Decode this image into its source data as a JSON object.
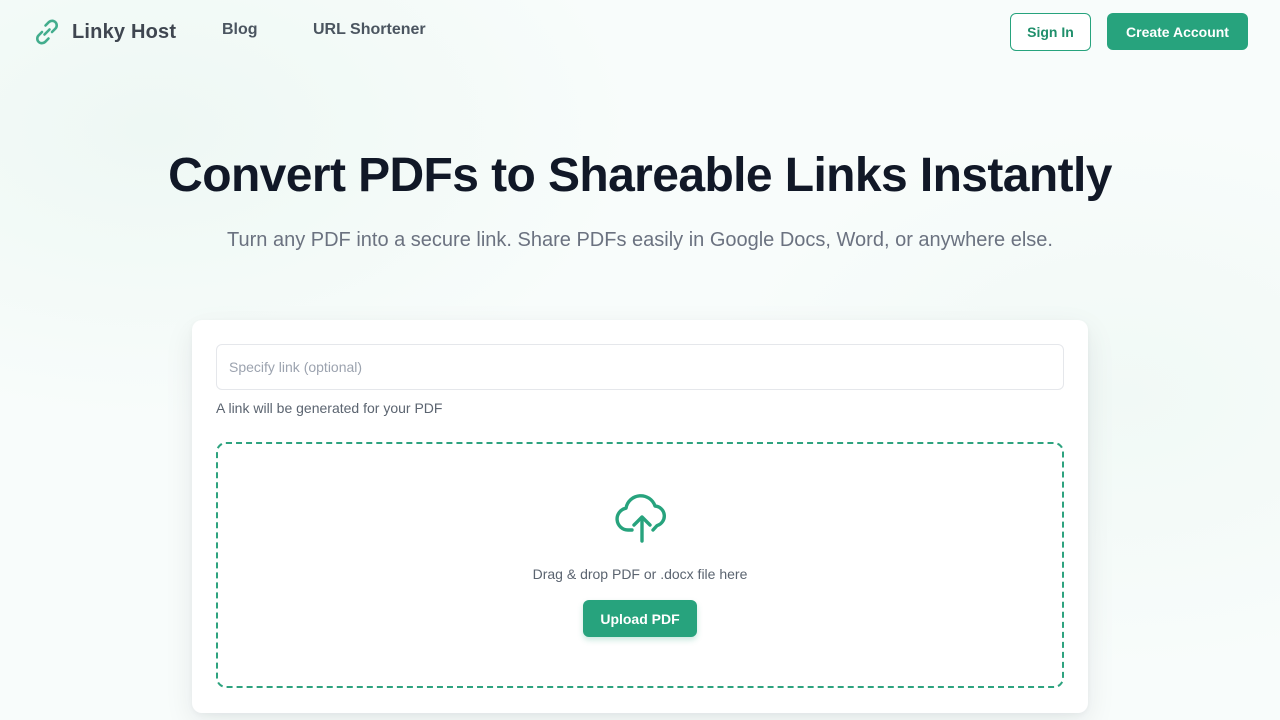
{
  "header": {
    "brand": "Linky Host",
    "nav": [
      "Blog",
      "URL Shortener"
    ],
    "sign_in": "Sign In",
    "create_account": "Create Account"
  },
  "hero": {
    "title": "Convert PDFs to Shareable Links Instantly",
    "subtitle": "Turn any PDF into a secure link. Share PDFs easily in Google Docs, Word, or anywhere else."
  },
  "uploader": {
    "link_placeholder": "Specify link (optional)",
    "link_value": "",
    "helper_text": "A link will be generated for your PDF",
    "drop_text": "Drag & drop PDF or .docx file here",
    "upload_button": "Upload PDF"
  },
  "icons": {
    "logo": "link-chain-icon",
    "upload": "cloud-upload-icon"
  },
  "colors": {
    "accent": "#27a37d",
    "heading": "#111827",
    "muted": "#6b7280"
  }
}
